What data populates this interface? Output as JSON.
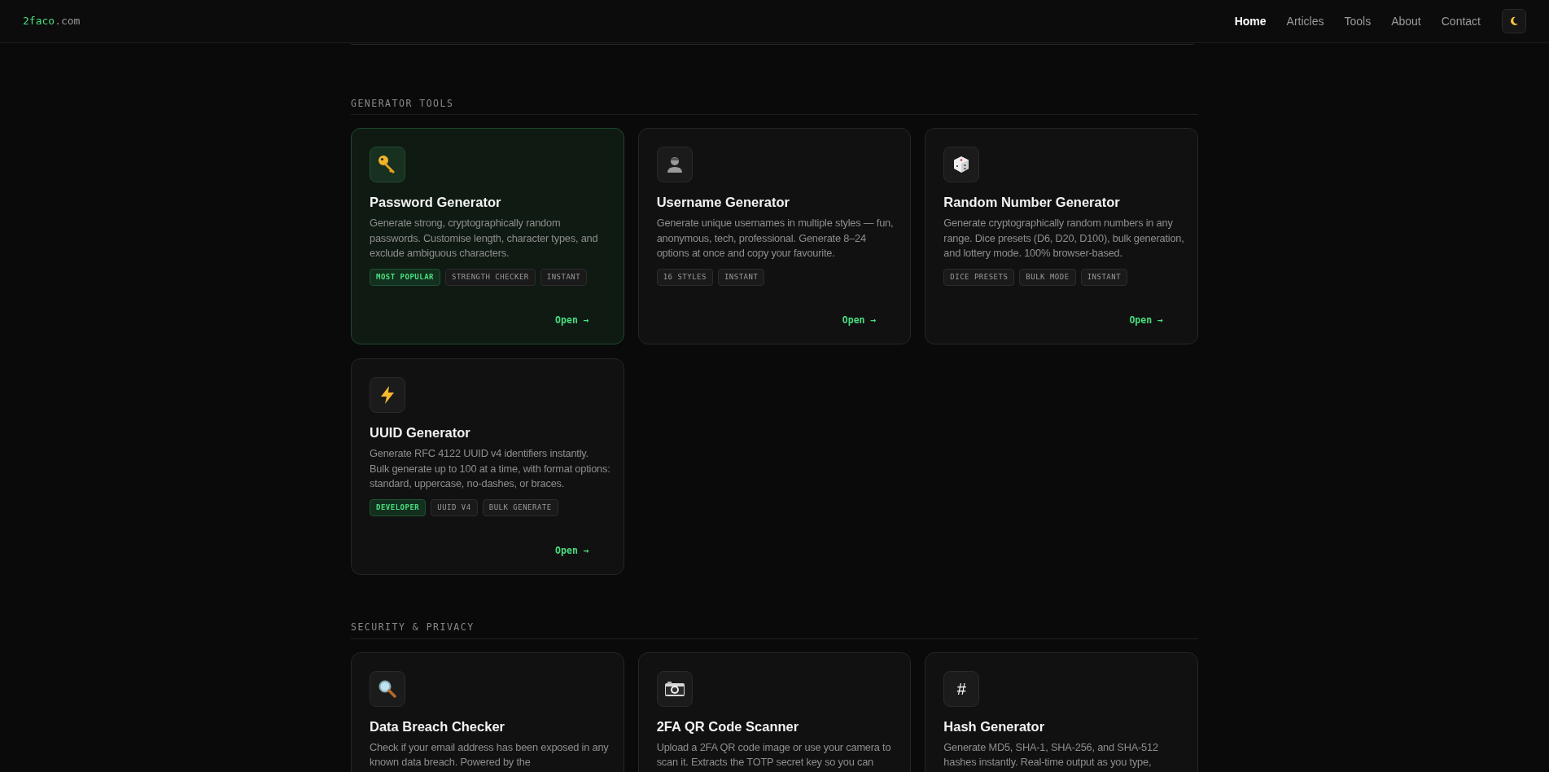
{
  "header": {
    "logo": {
      "name": "2faco",
      "suffix": ".com"
    },
    "nav": [
      {
        "label": "Home",
        "selected": true
      },
      {
        "label": "Articles",
        "selected": false
      },
      {
        "label": "Tools",
        "selected": false
      },
      {
        "label": "About",
        "selected": false
      },
      {
        "label": "Contact",
        "selected": false
      }
    ]
  },
  "sections": [
    {
      "heading": "GENERATOR TOOLS",
      "cards": [
        {
          "title": "Password Generator",
          "featured": true,
          "description": "Generate strong, cryptographically random passwords. Customise length, character types, and exclude ambiguous characters.",
          "tags": [
            {
              "label": "MOST POPULAR",
              "kind": "highlight"
            },
            {
              "label": "STRENGTH CHECKER",
              "kind": "plain"
            },
            {
              "label": "INSTANT",
              "kind": "plain"
            }
          ],
          "link": "Open →"
        },
        {
          "title": "Username Generator",
          "featured": false,
          "description": "Generate unique usernames in multiple styles — fun, anonymous, tech, professional. Generate 8–24 options at once and copy your favourite.",
          "tags": [
            {
              "label": "16 STYLES",
              "kind": "plain"
            },
            {
              "label": "INSTANT",
              "kind": "plain"
            }
          ],
          "link": "Open →"
        },
        {
          "title": "Random Number Generator",
          "featured": false,
          "description": "Generate cryptographically random numbers in any range. Dice presets (D6, D20, D100), bulk generation, and lottery mode. 100% browser-based.",
          "tags": [
            {
              "label": "DICE PRESETS",
              "kind": "plain"
            },
            {
              "label": "BULK MODE",
              "kind": "plain"
            },
            {
              "label": "INSTANT",
              "kind": "plain"
            }
          ],
          "link": "Open →"
        },
        {
          "title": "UUID Generator",
          "featured": false,
          "description": "Generate RFC 4122 UUID v4 identifiers instantly. Bulk generate up to 100 at a time, with format options: standard, uppercase, no-dashes, or braces.",
          "tags": [
            {
              "label": "DEVELOPER",
              "kind": "highlight"
            },
            {
              "label": "UUID V4",
              "kind": "plain"
            },
            {
              "label": "BULK GENERATE",
              "kind": "plain"
            }
          ],
          "link": "Open →"
        }
      ]
    },
    {
      "heading": "SECURITY & PRIVACY",
      "cards": [
        {
          "title": "Data Breach Checker",
          "featured": false,
          "description": "Check if your email address has been exposed in any known data breach. Powered by the"
        },
        {
          "title": "2FA QR Code Scanner",
          "featured": false,
          "description": "Upload a 2FA QR code image or use your camera to scan it. Extracts the TOTP secret key so you can"
        },
        {
          "icon_text": "#",
          "title": "Hash Generator",
          "featured": false,
          "description": "Generate MD5, SHA-1, SHA-256, and SHA-512 hashes instantly. Real-time output as you type,"
        }
      ]
    }
  ]
}
